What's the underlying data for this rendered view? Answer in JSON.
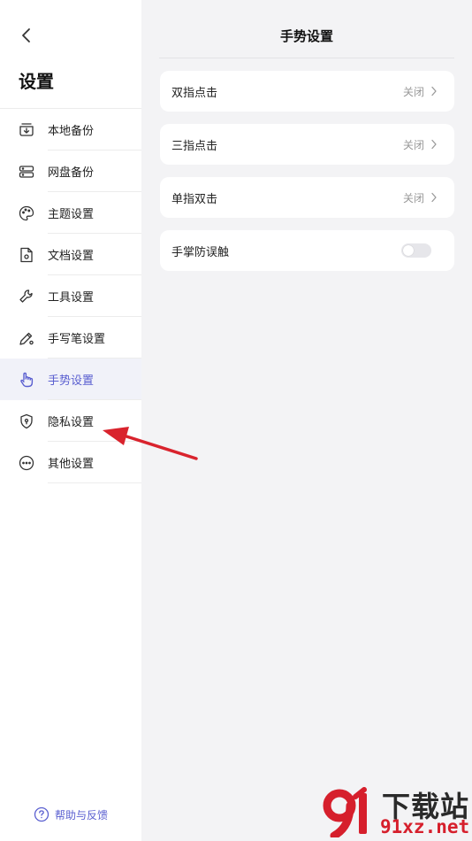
{
  "sidebar": {
    "title": "设置",
    "items": [
      {
        "label": "本地备份",
        "icon": "local-backup-icon"
      },
      {
        "label": "网盘备份",
        "icon": "cloud-backup-icon"
      },
      {
        "label": "主题设置",
        "icon": "palette-icon"
      },
      {
        "label": "文档设置",
        "icon": "document-icon"
      },
      {
        "label": "工具设置",
        "icon": "wrench-icon"
      },
      {
        "label": "手写笔设置",
        "icon": "pen-icon"
      },
      {
        "label": "手势设置",
        "icon": "hand-gesture-icon",
        "active": true
      },
      {
        "label": "隐私设置",
        "icon": "shield-icon"
      },
      {
        "label": "其他设置",
        "icon": "more-icon"
      }
    ],
    "help_label": "帮助与反馈"
  },
  "main": {
    "title": "手势设置",
    "settings": [
      {
        "label": "双指点击",
        "value": "关闭",
        "type": "select"
      },
      {
        "label": "三指点击",
        "value": "关闭",
        "type": "select"
      },
      {
        "label": "单指双击",
        "value": "关闭",
        "type": "select"
      },
      {
        "label": "手掌防误触",
        "type": "toggle",
        "on": false
      }
    ]
  },
  "colors": {
    "accent": "#5a5fd0",
    "annotation_arrow": "#d9232d",
    "sidebar_bg": "#ffffff",
    "main_bg": "#f3f3f5"
  },
  "watermark": {
    "text_top": "下载站",
    "text_bottom": "91xz.net"
  }
}
